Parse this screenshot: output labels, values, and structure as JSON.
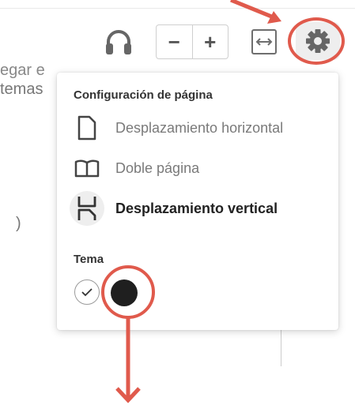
{
  "toolbar": {
    "zoom_out_label": "−",
    "zoom_in_label": "+",
    "icons": [
      "headphones-icon",
      "fit-width-icon",
      "gear-icon"
    ]
  },
  "background_text": {
    "line1": "egar e",
    "line2": "temas",
    "line3": ")"
  },
  "settings_panel": {
    "page_config_heading": "Configuración de página",
    "layout_options": [
      {
        "label": "Desplazamiento horizontal",
        "icon": "page-icon",
        "selected": false
      },
      {
        "label": "Doble página",
        "icon": "book-icon",
        "selected": false
      },
      {
        "label": "Desplazamiento vertical",
        "icon": "vertical-scroll-icon",
        "selected": true
      }
    ],
    "theme_heading": "Tema",
    "themes": [
      {
        "name": "light",
        "selected": true
      },
      {
        "name": "dark",
        "selected": false
      }
    ]
  },
  "colors": {
    "annotation_red": "#e05a4c",
    "dark_theme": "#1f1f1f",
    "selected_bg": "#eeeeee"
  }
}
